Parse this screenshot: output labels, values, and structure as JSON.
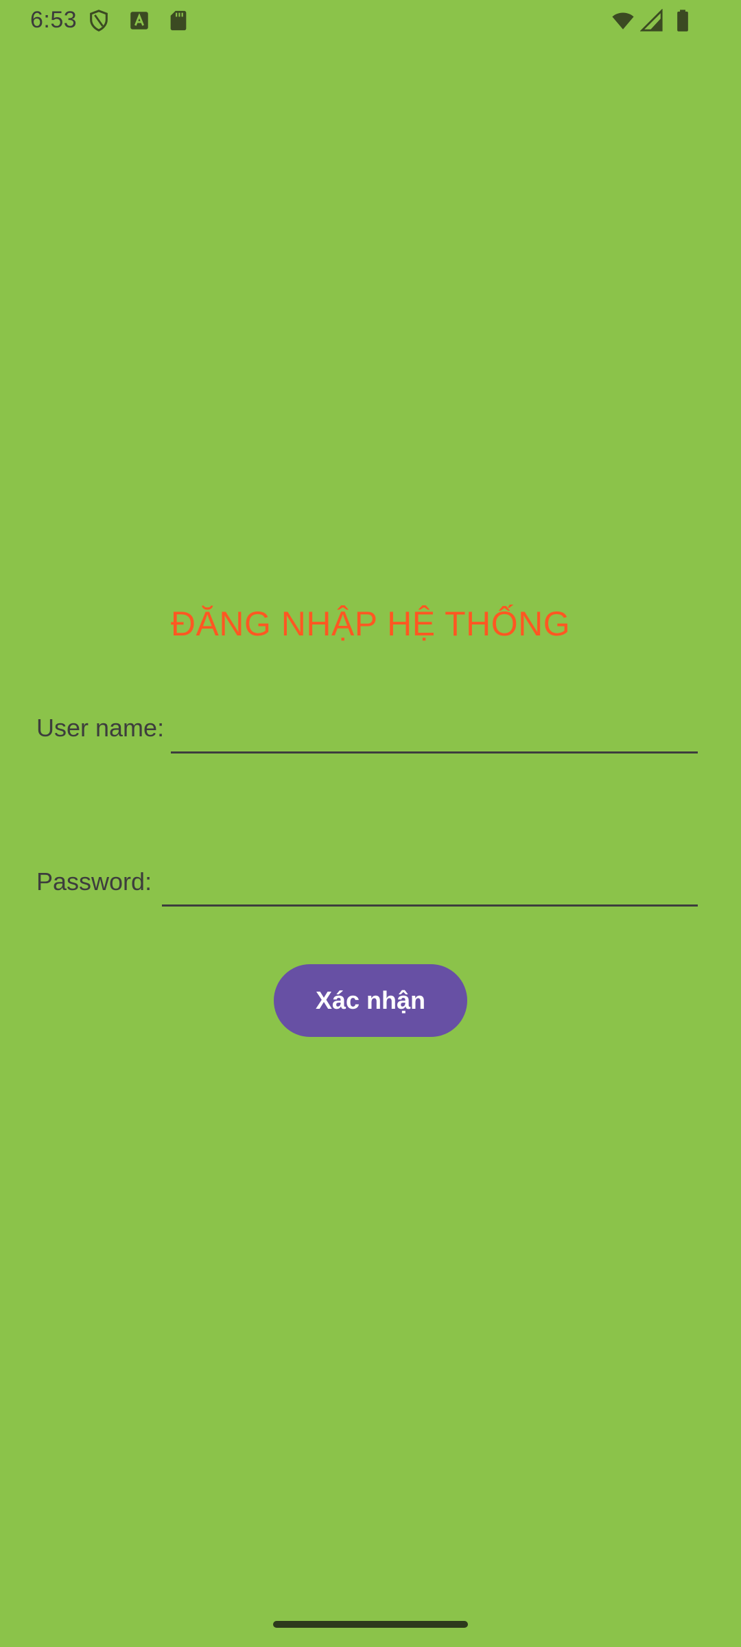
{
  "status_bar": {
    "time": "6:53",
    "left_icons": [
      "shield-icon",
      "text-a-icon",
      "sd-card-icon"
    ],
    "right_icons": [
      "wifi-icon",
      "signal-icon",
      "battery-icon"
    ],
    "icon_color": "#3b4a22"
  },
  "login": {
    "title": "ĐĂNG NHẬP HỆ THỐNG",
    "username_label": "User name:",
    "username_value": "",
    "password_label": "Password:",
    "password_value": "",
    "confirm_label": "Xác nhận"
  },
  "colors": {
    "background": "#8bc34a",
    "title": "#ff5722",
    "button": "#6750a4",
    "button_text": "#ffffff"
  }
}
